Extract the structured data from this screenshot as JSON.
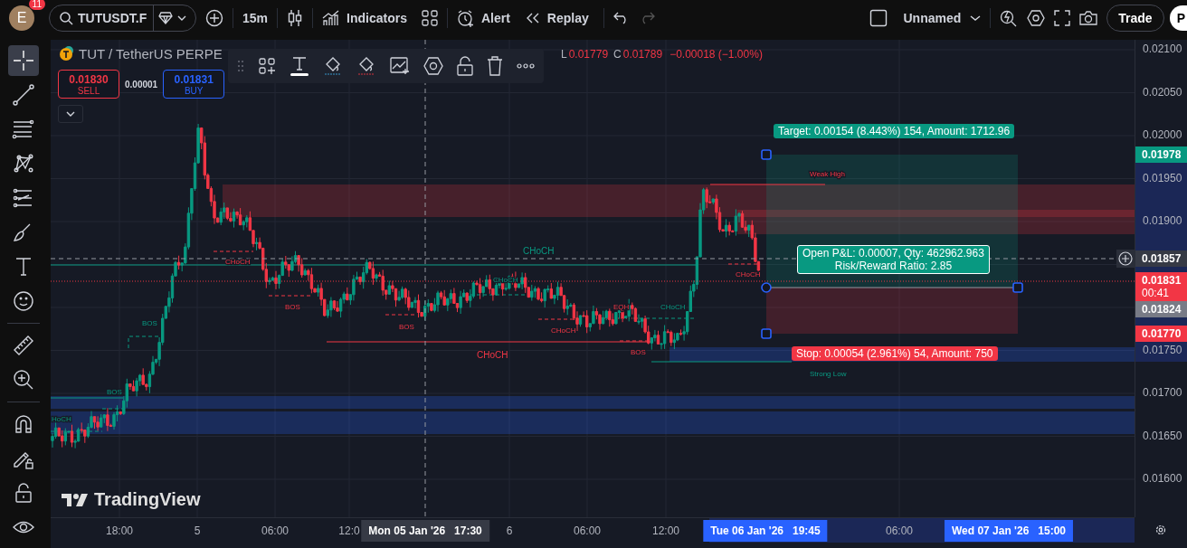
{
  "top_bar": {
    "avatar": "E",
    "notification_count": "11",
    "symbol": "TUTUSDT.F",
    "interval": "15m",
    "indicators": "Indicators",
    "alert": "Alert",
    "replay": "Replay",
    "layout_name": "Unnamed",
    "trade": "Trade",
    "publish": "P"
  },
  "left_toolbar": [
    {
      "kind": "crosshair",
      "selected": true
    },
    {
      "kind": "line",
      "selected": false
    },
    {
      "kind": "fib",
      "selected": false
    },
    {
      "kind": "pattern",
      "selected": false
    },
    {
      "kind": "forecast",
      "selected": false
    },
    {
      "kind": "brush",
      "selected": false
    },
    {
      "kind": "text",
      "selected": false
    },
    {
      "kind": "emoji",
      "selected": false
    },
    {
      "kind": "ruler",
      "selected": false
    },
    {
      "kind": "zoom",
      "selected": false
    },
    {
      "kind": "magnet",
      "selected": false
    },
    {
      "kind": "pencil-lock",
      "selected": false
    },
    {
      "kind": "lock",
      "selected": false
    },
    {
      "kind": "eye",
      "selected": false
    }
  ],
  "legend": {
    "title": "TUT / TetherUS PERPE",
    "low_label": "L",
    "low": "0.01779",
    "close_label": "C",
    "close": "0.01789",
    "change": "−0.00018 (−1.00%)"
  },
  "order_buttons": {
    "sell_price": "0.01830",
    "sell": "SELL",
    "spread": "0.00001",
    "buy_price": "0.01831",
    "buy": "BUY"
  },
  "chart": {
    "annotations": [
      {
        "text": "HoCH",
        "kind": "bullish"
      },
      {
        "text": "BOS",
        "kind": "bullish"
      },
      {
        "text": "BOS",
        "kind": "bullish"
      },
      {
        "text": "CHoCH",
        "kind": "bearish"
      },
      {
        "text": "BOS",
        "kind": "bearish"
      },
      {
        "text": "BOS",
        "kind": "bearish"
      },
      {
        "text": "CHoCH",
        "kind": "bullish"
      },
      {
        "text": "CHoCH",
        "kind": "bullish"
      },
      {
        "text": "CHoCH",
        "kind": "bearish"
      },
      {
        "text": "CHoCH",
        "kind": "bearish"
      },
      {
        "text": "EQH",
        "kind": "bearish"
      },
      {
        "text": "CHoCH",
        "kind": "bullish"
      },
      {
        "text": "BOS",
        "kind": "bearish"
      },
      {
        "text": "CHoCH",
        "kind": "bearish"
      },
      {
        "text": "Weak High",
        "kind": "bearish"
      },
      {
        "text": "Strong Low",
        "kind": "bullish"
      }
    ],
    "target_label": "Target: 0.00154 (8.443%) 154, Amount: 1712.96",
    "pnl_lines": [
      "Open P&L: 0.00007, Qty: 462962.963",
      "Risk/Reward Ratio: 2.85"
    ],
    "stop_label": "Stop: 0.00054 (2.961%) 54, Amount: 750",
    "logo_text": "TradingView"
  },
  "price_axis": {
    "ticks": [
      "0.02100",
      "0.02050",
      "0.02000",
      "0.01950",
      "0.01900",
      "0.01750",
      "0.01700",
      "0.01650",
      "0.01600"
    ],
    "tags": [
      {
        "kind": "target",
        "text": "0.01978"
      },
      {
        "kind": "crosshair",
        "text": "0.01857"
      },
      {
        "kind": "last",
        "text": "0.01831",
        "countdown": "00:41"
      },
      {
        "kind": "entry",
        "text": "0.01824"
      },
      {
        "kind": "stop",
        "text": "0.01770"
      }
    ]
  },
  "time_axis": {
    "ticks": [
      "18:00",
      "5",
      "06:00",
      "12:0",
      "6",
      "06:00",
      "12:00",
      "06:00"
    ],
    "tags": [
      {
        "kind": "crosshair",
        "date": "Mon 05 Jan '26",
        "time": "17:30"
      },
      {
        "kind": "range",
        "date": "Tue 06 Jan '26",
        "time": "19:45"
      },
      {
        "kind": "range",
        "date": "Wed 07 Jan '26",
        "time": "15:00"
      }
    ]
  }
}
